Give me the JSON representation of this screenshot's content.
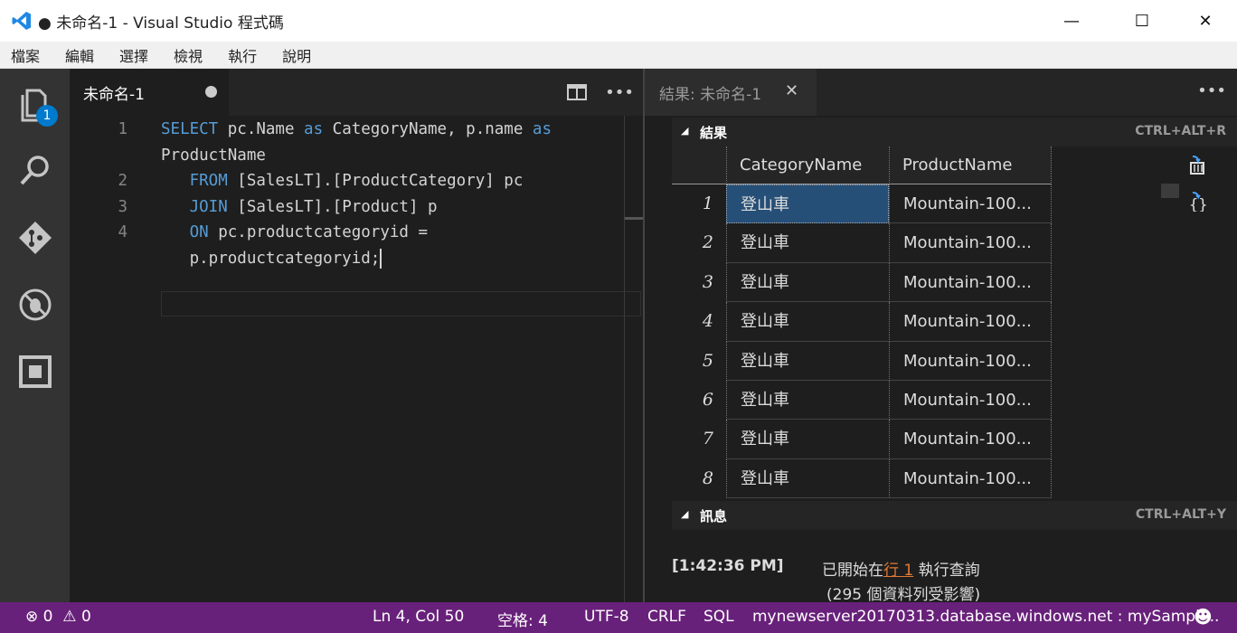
{
  "window": {
    "title": "● 未命名-1 - Visual Studio 程式碼",
    "minimize": "—",
    "maximize": "☐",
    "close": "✕"
  },
  "menu": [
    "檔案",
    "編輯",
    "選擇",
    "檢視",
    "執行",
    "說明"
  ],
  "activity": {
    "explorer_badge": "1"
  },
  "editor": {
    "tab_label": "未命名-1",
    "lines": [
      {
        "num": "1",
        "tokens": [
          [
            "kw",
            "SELECT"
          ],
          [
            "t",
            " pc.Name "
          ],
          [
            "kw",
            "as"
          ],
          [
            "t",
            " CategoryName, p.name "
          ],
          [
            "kw",
            "as"
          ]
        ]
      },
      {
        "num": "",
        "tokens": [
          [
            "t",
            "ProductName"
          ]
        ]
      },
      {
        "num": "2",
        "tokens": [
          [
            "t",
            "   "
          ],
          [
            "kw",
            "FROM"
          ],
          [
            "t",
            " [SalesLT].[ProductCategory] pc"
          ]
        ]
      },
      {
        "num": "3",
        "tokens": [
          [
            "t",
            "   "
          ],
          [
            "kw",
            "JOIN"
          ],
          [
            "t",
            " [SalesLT].[Product] p"
          ]
        ]
      },
      {
        "num": "4",
        "tokens": [
          [
            "t",
            "   "
          ],
          [
            "kw",
            "ON"
          ],
          [
            "t",
            " pc.productcategoryid ="
          ]
        ]
      },
      {
        "num": "",
        "tokens": [
          [
            "t",
            "   p.productcategoryid;"
          ]
        ]
      }
    ]
  },
  "results": {
    "tab_label": "結果: 未命名-1",
    "results_header": "結果",
    "results_shortcut": "CTRL+ALT+R",
    "columns": [
      "CategoryName",
      "ProductName"
    ],
    "rows": [
      [
        "1",
        "登山車",
        "Mountain-100..."
      ],
      [
        "2",
        "登山車",
        "Mountain-100..."
      ],
      [
        "3",
        "登山車",
        "Mountain-100..."
      ],
      [
        "4",
        "登山車",
        "Mountain-100..."
      ],
      [
        "5",
        "登山車",
        "Mountain-100..."
      ],
      [
        "6",
        "登山車",
        "Mountain-100..."
      ],
      [
        "7",
        "登山車",
        "Mountain-100..."
      ],
      [
        "8",
        "登山車",
        "Mountain-100..."
      ]
    ],
    "messages_header": "訊息",
    "messages_shortcut": "CTRL+ALT+Y",
    "message_time": "[1:42:36 PM]",
    "message_prefix": "已開始在",
    "message_link": "行 1",
    "message_suffix": "執行查詢",
    "message_rows": "(295 個資料列受影響)"
  },
  "status": {
    "errors": "0",
    "warnings": "0",
    "position": "Ln 4, Col 50",
    "spaces": "空格: 4",
    "encoding": "UTF-8",
    "eol": "CRLF",
    "language": "SQL",
    "connection": "mynewserver20170313.database.windows.net : mySampl ..."
  },
  "colors": {
    "statusbar": "#68217a",
    "keyword": "#569cd6",
    "link": "#e37933",
    "selection": "#264f78"
  }
}
